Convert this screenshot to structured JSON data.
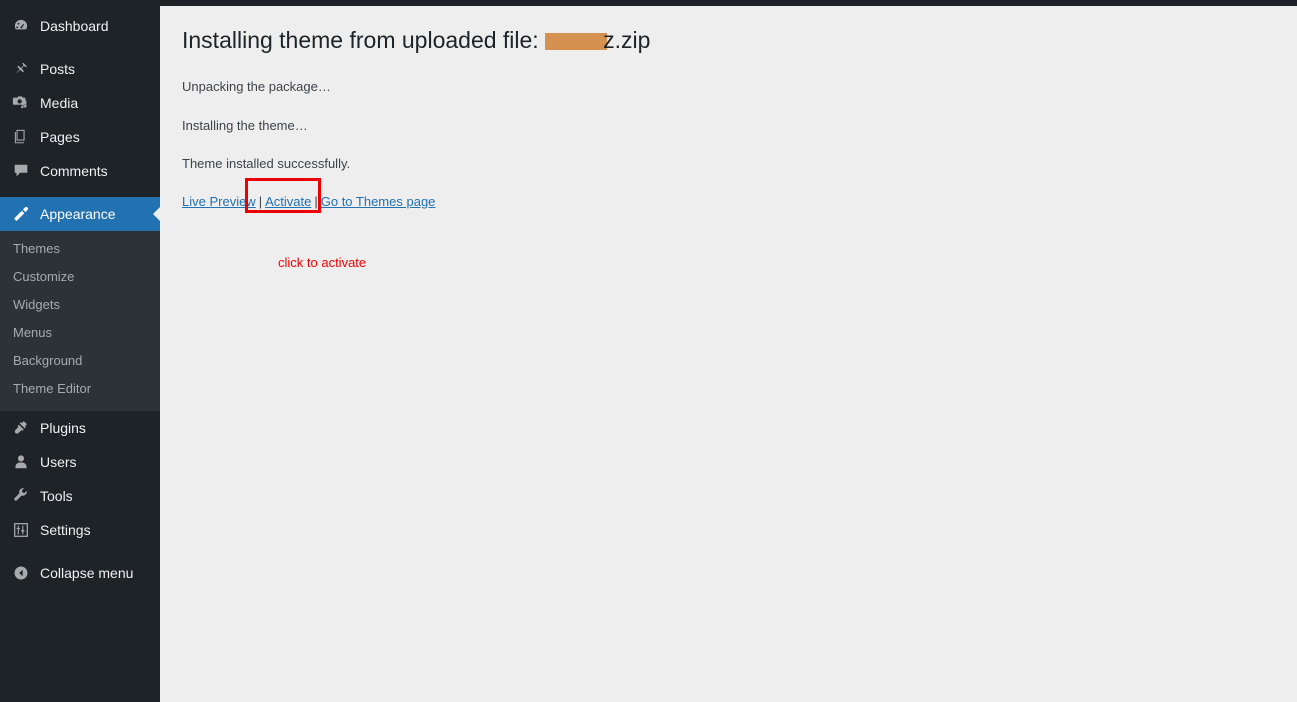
{
  "sidebar": {
    "items": [
      {
        "label": "Dashboard",
        "icon": "dashboard-gauge-icon",
        "name": "dashboard"
      },
      {
        "label": "Posts",
        "icon": "pin-icon",
        "name": "posts"
      },
      {
        "label": "Media",
        "icon": "media-camera-music-icon",
        "name": "media"
      },
      {
        "label": "Pages",
        "icon": "page-document-icon",
        "name": "pages"
      },
      {
        "label": "Comments",
        "icon": "comment-bubble-icon",
        "name": "comments"
      },
      {
        "label": "Appearance",
        "icon": "paintbrush-icon",
        "name": "appearance",
        "current": true
      },
      {
        "label": "Plugins",
        "icon": "plug-icon",
        "name": "plugins"
      },
      {
        "label": "Users",
        "icon": "user-icon",
        "name": "users"
      },
      {
        "label": "Tools",
        "icon": "wrench-icon",
        "name": "tools"
      },
      {
        "label": "Settings",
        "icon": "sliders-icon",
        "name": "settings"
      }
    ],
    "submenu": [
      {
        "label": "Themes",
        "name": "themes"
      },
      {
        "label": "Customize",
        "name": "customize"
      },
      {
        "label": "Widgets",
        "name": "widgets"
      },
      {
        "label": "Menus",
        "name": "menus"
      },
      {
        "label": "Background",
        "name": "background"
      },
      {
        "label": "Theme Editor",
        "name": "theme-editor"
      }
    ],
    "collapse": {
      "label": "Collapse menu",
      "icon": "collapse-arrow-circle-icon"
    }
  },
  "main": {
    "title_prefix": "Installing theme from uploaded file:",
    "title_suffix": "z.zip",
    "statuses": [
      "Unpacking the package…",
      "Installing the theme…",
      "Theme installed successfully."
    ],
    "links": [
      {
        "label": "Live Preview",
        "name": "live-preview"
      },
      {
        "label": "Activate",
        "name": "activate"
      },
      {
        "label": "Go to Themes page",
        "name": "go-to-themes-page"
      }
    ],
    "separator": "|",
    "annotation": "click to activate"
  },
  "colors": {
    "sidebar_bg": "#1d2327",
    "submenu_bg": "#2c3338",
    "current_blue": "#2271b1",
    "content_bg": "#eeeeee",
    "link_blue": "#2271b1",
    "redaction": "#d4914f",
    "highlight_red": "#ee0000",
    "annotation_red": "#f00505"
  }
}
